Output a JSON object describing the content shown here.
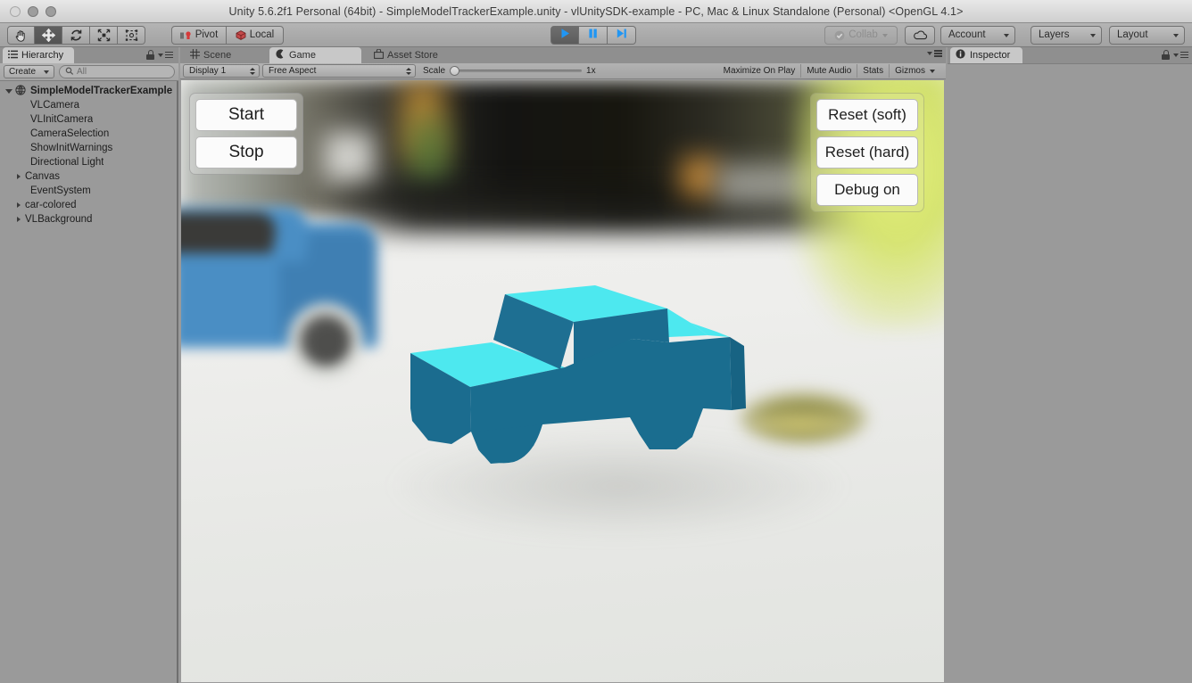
{
  "window": {
    "title": "Unity 5.6.2f1 Personal (64bit) - SimpleModelTrackerExample.unity - vlUnitySDK-example - PC, Mac & Linux Standalone (Personal) <OpenGL 4.1>",
    "traffic_lights": [
      "close",
      "minimize",
      "maximize"
    ]
  },
  "toolbar": {
    "transform_tools": [
      {
        "name": "hand-tool",
        "icon": "hand-icon",
        "selected": false
      },
      {
        "name": "move-tool",
        "icon": "move-icon",
        "selected": true
      },
      {
        "name": "rotate-tool",
        "icon": "rotate-icon",
        "selected": false
      },
      {
        "name": "scale-tool",
        "icon": "scale-icon",
        "selected": false
      },
      {
        "name": "rect-tool",
        "icon": "rect-transform-icon",
        "selected": false
      }
    ],
    "pivot_label": "Pivot",
    "local_label": "Local",
    "play_label": "play-icon",
    "pause_label": "pause-icon",
    "step_label": "step-icon",
    "play_active": true,
    "collab_label": "Collab",
    "collab_enabled": false,
    "cloud_label": "cloud-icon",
    "account_label": "Account",
    "layers_label": "Layers",
    "layout_label": "Layout"
  },
  "hierarchy": {
    "tab_label": "Hierarchy",
    "create_label": "Create",
    "search_placeholder": "All",
    "items": [
      {
        "label": "SimpleModelTrackerExample",
        "depth": 0,
        "expanded": true,
        "has_children": true,
        "bold": true,
        "icon": "scene-icon"
      },
      {
        "label": "VLCamera",
        "depth": 1,
        "expanded": false,
        "has_children": false,
        "bold": false
      },
      {
        "label": "VLInitCamera",
        "depth": 1,
        "expanded": false,
        "has_children": false,
        "bold": false
      },
      {
        "label": "CameraSelection",
        "depth": 1,
        "expanded": false,
        "has_children": false,
        "bold": false
      },
      {
        "label": "ShowInitWarnings",
        "depth": 1,
        "expanded": false,
        "has_children": false,
        "bold": false
      },
      {
        "label": "Directional Light",
        "depth": 1,
        "expanded": false,
        "has_children": false,
        "bold": false
      },
      {
        "label": "Canvas",
        "depth": 1,
        "expanded": false,
        "has_children": true,
        "bold": false
      },
      {
        "label": "EventSystem",
        "depth": 1,
        "expanded": false,
        "has_children": false,
        "bold": false
      },
      {
        "label": "car-colored",
        "depth": 1,
        "expanded": false,
        "has_children": true,
        "bold": false
      },
      {
        "label": "VLBackground",
        "depth": 1,
        "expanded": false,
        "has_children": true,
        "bold": false
      }
    ]
  },
  "game_panel": {
    "tabs": [
      {
        "label": "Scene",
        "icon": "grid-icon",
        "active": false
      },
      {
        "label": "Game",
        "icon": "game-icon",
        "active": true
      },
      {
        "label": "Asset Store",
        "icon": "store-icon",
        "active": false
      }
    ],
    "display_label": "Display 1",
    "aspect_label": "Free Aspect",
    "scale_label": "Scale",
    "scale_value": "1x",
    "scale_percent": 0,
    "maximize_on_play_label": "Maximize On Play",
    "mute_audio_label": "Mute Audio",
    "stats_label": "Stats",
    "gizmos_label": "Gizmos"
  },
  "game_overlay": {
    "left_buttons": [
      "Start",
      "Stop"
    ],
    "right_buttons": [
      "Reset (soft)",
      "Reset (hard)",
      "Debug on"
    ]
  },
  "inspector": {
    "tab_label": "Inspector",
    "icon": "info-icon"
  },
  "colors": {
    "truck_body": "#1a6d8f",
    "truck_top": "#4de8ef",
    "truck_shadow": "#176383",
    "accent_blue": "#2196f3",
    "panel_gray": "#9a9a9a",
    "toolbar_gray": "#a9a9a9",
    "background_car_blue": "#4a8ec4",
    "background_yellow": "#d6e470"
  }
}
